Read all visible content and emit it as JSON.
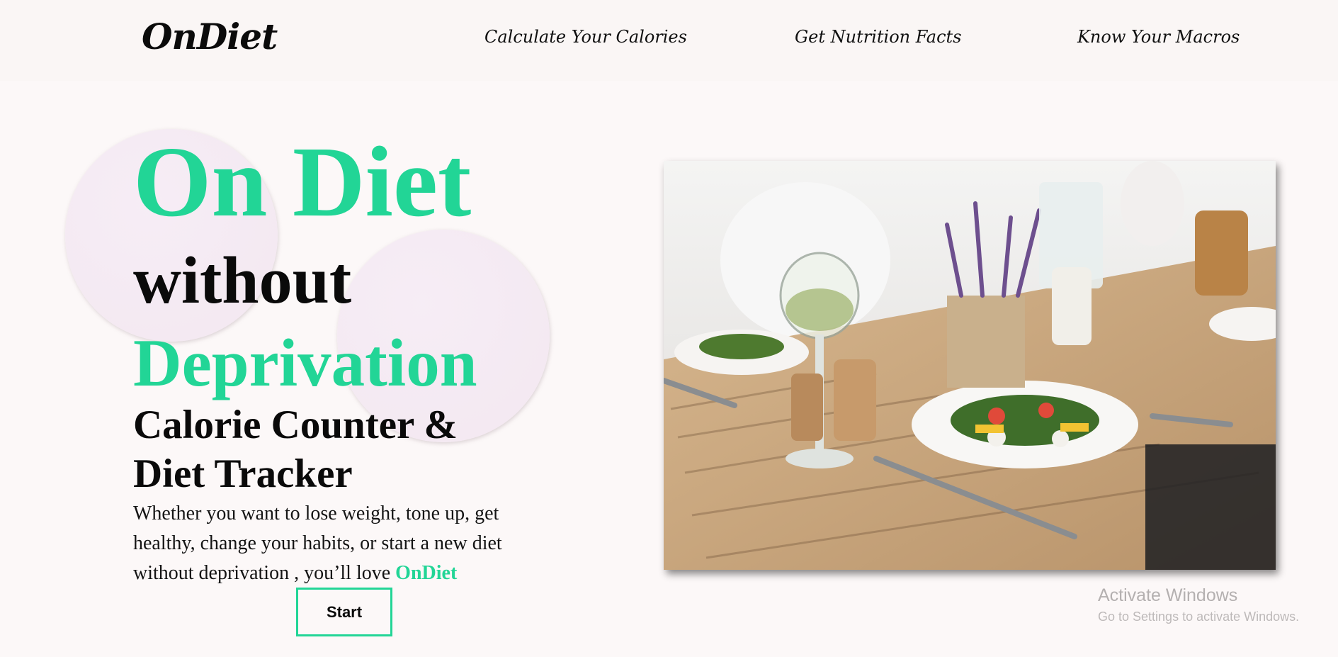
{
  "nav": {
    "logo": "OnDiet",
    "links": [
      "Calculate Your Calories",
      "Get Nutrition Facts",
      "Know Your Macros"
    ]
  },
  "hero": {
    "line1": "On Diet",
    "line2": "without",
    "line3": "Deprivation",
    "subtitle_line1": "Calorie Counter &",
    "subtitle_line2": "Diet Tracker",
    "description": "Whether you want to lose weight, tone up, get healthy, change your habits, or start a new diet without deprivation , you’ll love ",
    "brand": "OnDiet",
    "button": "Start",
    "image_icon": "dining-table-salad-photo"
  },
  "colors": {
    "accent": "#22d596",
    "text": "#0a0a0a",
    "background": "#fcf8f8"
  },
  "watermark": {
    "title": "Activate Windows",
    "subtitle": "Go to Settings to activate Windows."
  }
}
